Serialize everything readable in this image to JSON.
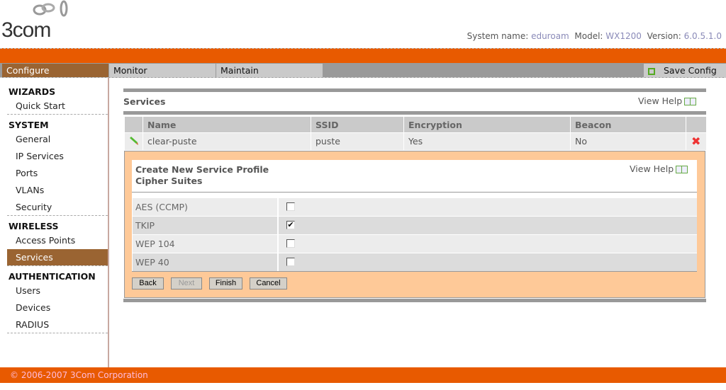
{
  "header": {
    "logo": "3com",
    "system_name_label": "System name:",
    "system_name": "eduroam",
    "model_label": "Model:",
    "model": "WX1200",
    "version_label": "Version:",
    "version": "6.0.5.1.0"
  },
  "nav": {
    "tabs": [
      "Configure",
      "Monitor",
      "Maintain"
    ],
    "active": "Configure",
    "save_config": "Save Config"
  },
  "sidebar": {
    "sections": [
      {
        "title": "WIZARDS",
        "items": [
          "Quick Start"
        ]
      },
      {
        "title": "SYSTEM",
        "items": [
          "General",
          "IP Services",
          "Ports",
          "VLANs",
          "Security"
        ]
      },
      {
        "title": "WIRELESS",
        "items": [
          "Access Points",
          "Services"
        ]
      },
      {
        "title": "AUTHENTICATION",
        "items": [
          "Users",
          "Devices",
          "RADIUS"
        ]
      }
    ],
    "active": "Services"
  },
  "services": {
    "title": "Services",
    "view_help": "View Help",
    "columns": [
      "Name",
      "SSID",
      "Encryption",
      "Beacon"
    ],
    "rows": [
      {
        "name": "clear-puste",
        "ssid": "puste",
        "encryption": "Yes",
        "beacon": "No"
      }
    ]
  },
  "wizard": {
    "title": "Create New Service Profile",
    "subtitle": "Cipher Suites",
    "view_help": "View Help",
    "ciphers": [
      {
        "label": "AES (CCMP)",
        "checked": false
      },
      {
        "label": "TKIP",
        "checked": true
      },
      {
        "label": "WEP 104",
        "checked": false
      },
      {
        "label": "WEP 40",
        "checked": false
      }
    ],
    "buttons": {
      "back": "Back",
      "next": "Next",
      "finish": "Finish",
      "cancel": "Cancel"
    }
  },
  "footer": {
    "copyright": "© 2006-2007 3Com Corporation"
  }
}
